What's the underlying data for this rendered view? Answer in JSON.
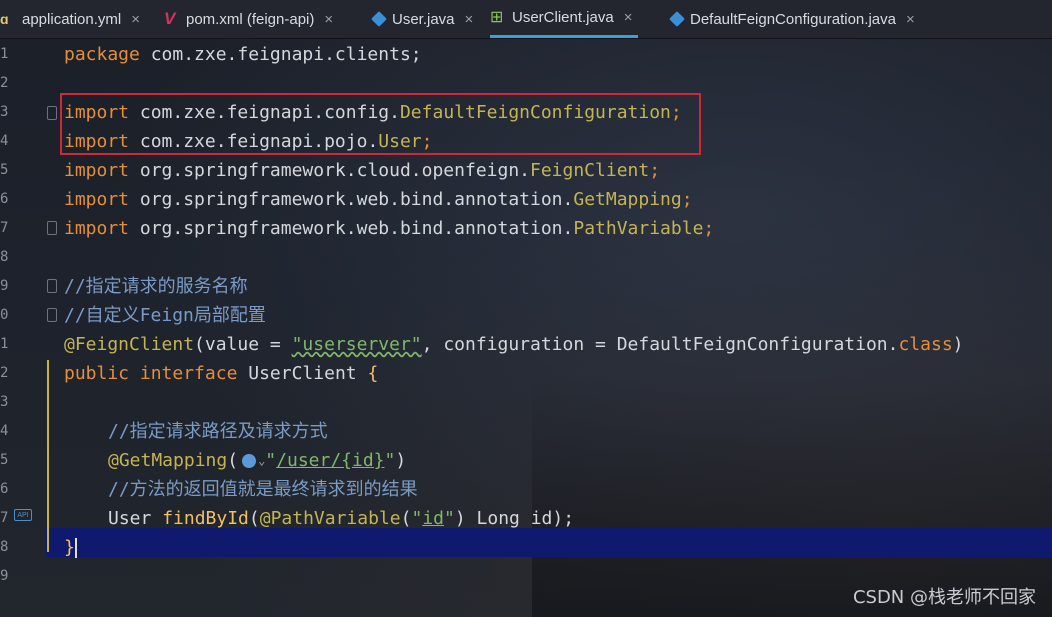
{
  "tabs": [
    {
      "label": "application.yml",
      "icon": "yaml-file-icon"
    },
    {
      "label": "pom.xml (feign-api)",
      "icon": "maven-file-icon"
    },
    {
      "label": "User.java",
      "icon": "java-class-icon"
    },
    {
      "label": "UserClient.java",
      "icon": "java-interface-icon",
      "active": true
    },
    {
      "label": "DefaultFeignConfiguration.java",
      "icon": "java-class-icon"
    }
  ],
  "close_glyph": "×",
  "line_numbers": [
    "1",
    "2",
    "3",
    "4",
    "5",
    "6",
    "7",
    "8",
    "9",
    "0",
    "1",
    "2",
    "3",
    "4",
    "5",
    "6",
    "7",
    "8",
    "9"
  ],
  "code": {
    "l1_kw": "package",
    "l1_rest": " com.zxe.feignapi.clients;",
    "l3_kw": "import",
    "l3_pkg": " com.zxe.feignapi.config.",
    "l3_cls": "DefaultFeignConfiguration",
    "l3_semi": ";",
    "l4_kw": "import",
    "l4_pkg": " com.zxe.feignapi.pojo.",
    "l4_cls": "User",
    "l4_semi": ";",
    "l5_kw": "import",
    "l5_pkg": " org.springframework.cloud.openfeign.",
    "l5_cls": "FeignClient",
    "l5_semi": ";",
    "l6_kw": "import",
    "l6_pkg": " org.springframework.web.bind.annotation.",
    "l6_cls": "GetMapping",
    "l6_semi": ";",
    "l7_kw": "import",
    "l7_pkg": " org.springframework.web.bind.annotation.",
    "l7_cls": "PathVariable",
    "l7_semi": ";",
    "l9_cmt": "//指定请求的服务名称",
    "l10_cmt_a": "//自定义",
    "l10_cmt_b": "Feign",
    "l10_cmt_c": "局部配置",
    "l11_ann": "@FeignClient",
    "l11_a": "(value = ",
    "l11_str": "\"userserver\"",
    "l11_b": ", configuration = DefaultFeignConfiguration.",
    "l11_cls": "class",
    "l11_c": ")",
    "l12_kw1": "public",
    "l12_kw2": " interface",
    "l12_name": " UserClient ",
    "l12_brace": "{",
    "l14_cmt": "//指定请求路径及请求方式",
    "l15_ann": "@GetMapping",
    "l15_paren": "(",
    "l15_chev": "⌄",
    "l15_q1": "\"",
    "l15_path": "/user/{id}",
    "l15_q2": "\"",
    "l15_close": ")",
    "l16_cmt": "//方法的返回值就是最终请求到的结果",
    "l17_type": "User ",
    "l17_fn": "findById",
    "l17_paren": "(",
    "l17_ann": "@PathVariable",
    "l17_p2": "(",
    "l17_q1": "\"",
    "l17_str": "id",
    "l17_q2": "\"",
    "l17_rest": ") Long id);",
    "l18_brace": "}"
  },
  "api_badge": "API",
  "watermark": "CSDN @栈老师不回家"
}
